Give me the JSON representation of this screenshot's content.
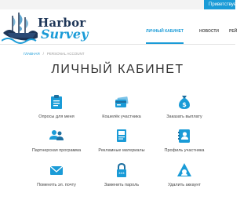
{
  "topbar": {
    "greeting": "Приветствуем"
  },
  "logo": {
    "line1": "Harbor",
    "line2": "Survey"
  },
  "nav": {
    "items": [
      "ЛИЧНЫЙ КАБИНЕТ",
      "НОВОСТИ",
      "РЕЙ"
    ]
  },
  "breadcrumb": {
    "home": "ГЛАВНАЯ",
    "separator": "/",
    "current": "PERSONAL ACCOUNT"
  },
  "page_title": "ЛИЧНЫЙ КАБИНЕТ",
  "colors": {
    "accent": "#1a9bd7",
    "dark_navy": "#1d3557"
  },
  "tiles": [
    {
      "label": "Опросы для меня",
      "icon": "clipboard-icon"
    },
    {
      "label": "Кошелёк участника",
      "icon": "wallet-icon"
    },
    {
      "label": "Заказать выплату",
      "icon": "money-bag-icon"
    },
    {
      "label": "Партнерская программа",
      "icon": "partners-icon"
    },
    {
      "label": "Рекламные материалы",
      "icon": "promo-materials-icon"
    },
    {
      "label": "Профиль участника",
      "icon": "profile-card-icon"
    },
    {
      "label": "Поменять эл. почту",
      "icon": "email-icon"
    },
    {
      "label": "Заменить пароль",
      "icon": "lock-icon"
    },
    {
      "label": "Удалить аккаунт",
      "icon": "delete-account-icon"
    }
  ]
}
